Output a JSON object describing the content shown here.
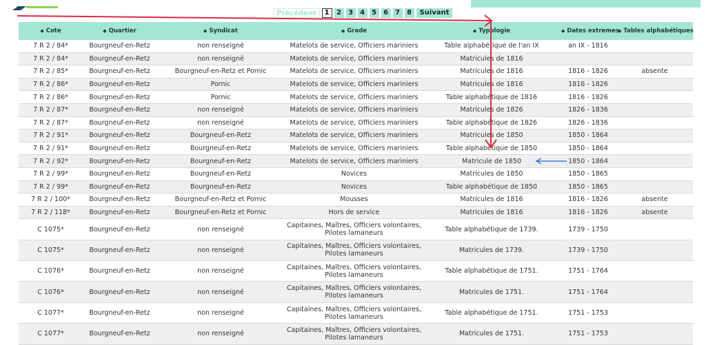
{
  "pagination": {
    "prev_label": "Précédent",
    "pages": [
      "1",
      "2",
      "3",
      "4",
      "5",
      "6",
      "7",
      "8"
    ],
    "current": "1",
    "next_label": "Suivant"
  },
  "table": {
    "columns": [
      "Cote",
      "Quartier",
      "Syndicat",
      "Grade",
      "Typologie",
      "Dates extremes",
      "Tables alphabétiques"
    ],
    "rows": [
      [
        "7 R 2 / 84*",
        "Bourgneuf-en-Retz",
        "non renseigné",
        "Matelots de service, Officiers mariniers",
        "Table alphabétique de l'an IX",
        "an IX - 1816",
        ""
      ],
      [
        "7 R 2 / 84*",
        "Bourgneuf-en-Retz",
        "non renseigné",
        "Matelots de service, Officiers mariniers",
        "Matricules de 1816",
        "",
        ""
      ],
      [
        "7 R 2 / 85*",
        "Bourgneuf-en-Retz",
        "Bourgneuf-en-Retz et Pornic",
        "Matelots de service, Officiers mariniers",
        "Matricules de 1816",
        "1816 - 1826",
        "absente"
      ],
      [
        "7 R 2 / 86*",
        "Bourgneuf-en-Retz",
        "Pornic",
        "Matelots de service, Officiers mariniers",
        "Matricules de 1816",
        "1816 - 1826",
        ""
      ],
      [
        "7 R 2 / 86*",
        "Bourgneuf-en-Retz",
        "Pornic",
        "Matelots de service, Officiers mariniers",
        "Table alphabétique de 1816",
        "1816 - 1826",
        ""
      ],
      [
        "7 R 2 / 87*",
        "Bourgneuf-en-Retz",
        "non renseigné",
        "Matelots de service, Officiers mariniers",
        "Matricules de 1826",
        "1826 - 1836",
        ""
      ],
      [
        "7 R 2 / 87*",
        "Bourgneuf-en-Retz",
        "non renseigné",
        "Matelots de service, Officiers mariniers",
        "Table alphabétique de 1826",
        "1826 - 1836",
        ""
      ],
      [
        "7 R 2 / 91*",
        "Bourgneuf-en-Retz",
        "Bourgneuf-en-Retz",
        "Matelots de service, Officiers mariniers",
        "Matricules de 1850",
        "1850 - 1864",
        ""
      ],
      [
        "7 R 2 / 91*",
        "Bourgneuf-en-Retz",
        "Bourgneuf-en-Retz",
        "Matelots de service, Officiers mariniers",
        "Table alphabétique de 1850",
        "1850 - 1864",
        ""
      ],
      [
        "7 R 2 / 92*",
        "Bourgneuf-en-Retz",
        "Bourgneuf-en-Retz",
        "Matelots de service, Officiers mariniers",
        "Matricule de 1850",
        "1850 - 1864",
        ""
      ],
      [
        "7 R 2 / 99*",
        "Bourgneuf-en-Retz",
        "Bourgneuf-en-Retz",
        "Novices",
        "Matricules de 1850",
        "1850 - 1865",
        ""
      ],
      [
        "7 R 2 / 99*",
        "Bourgneuf-en-Retz",
        "Bourgneuf-en-Retz",
        "Novices",
        "Table alphabétique de 1850",
        "1850 - 1865",
        ""
      ],
      [
        "7 R 2 / 100*",
        "Bourgneuf-en-Retz",
        "Bourgneuf-en-Retz et Pornic",
        "Mousses",
        "Matricules de 1816",
        "1816 - 1826",
        "absente"
      ],
      [
        "7 R 2 / 118*",
        "Bourgneuf-en-Retz",
        "Bourgneuf-en-Retz et Pornic",
        "Hors de service",
        "Matricules de 1816",
        "1816 - 1826",
        "absente"
      ],
      [
        "C 1075*",
        "Bourgneuf-en-Retz",
        "non renseigné",
        "Capitaines, Maîtres, Officiers volontaires, Pilotes lamaneurs",
        "Table alphabétique de 1739.",
        "1739 - 1750",
        ""
      ],
      [
        "C 1075*",
        "Bourgneuf-en-Retz",
        "non renseigné",
        "Capitaines, Maîtres, Officiers volontaires, Pilotes lamaneurs",
        "Matricules de 1739.",
        "1739 - 1750",
        ""
      ],
      [
        "C 1076*",
        "Bourgneuf-en-Retz",
        "non renseigné",
        "Capitaines, Maîtres, Officiers volontaires, Pilotes lamaneurs",
        "Table alphabétique de 1751.",
        "1751 - 1764",
        ""
      ],
      [
        "C 1076*",
        "Bourgneuf-en-Retz",
        "non renseigné",
        "Capitaines, Maîtres, Officiers volontaires, Pilotes lamaneurs",
        "Matricules de 1751.",
        "1751 - 1764",
        ""
      ],
      [
        "C 1077*",
        "Bourgneuf-en-Retz",
        "non renseigné",
        "Capitaines, Maîtres, Officiers volontaires, Pilotes lamaneurs",
        "Table alphabétique de 1751.",
        "1751 - 1753",
        ""
      ],
      [
        "C 1077*",
        "Bourgneuf-en-Retz",
        "non renseigné",
        "Capitaines, Maîtres, Officiers volontaires, Pilotes lamaneurs",
        "Matricules de 1751.",
        "1751 - 1753",
        ""
      ]
    ]
  },
  "icons": {
    "sort": "sort-icon"
  },
  "colors": {
    "accent": "#a3e6d6",
    "red_annotation": "#e0283c",
    "blue_annotation": "#3a7bd5",
    "logo_dark": "#1f4e5c",
    "logo_accent": "#8fd14f"
  }
}
